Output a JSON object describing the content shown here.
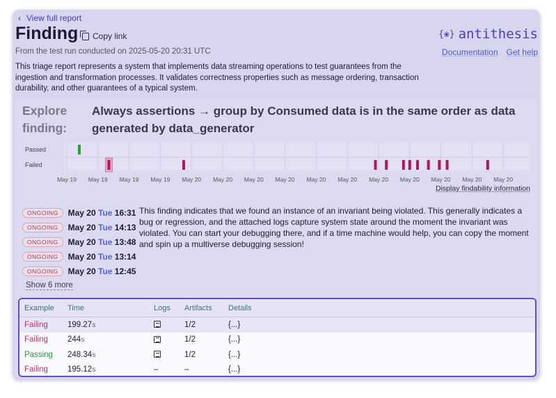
{
  "nav": {
    "back_label": "View full report"
  },
  "header": {
    "title": "Finding",
    "copy_link": "Copy link",
    "subtitle": "From the test run conducted on 2025-05-20 20:31 UTC",
    "logo_text": "antithesis",
    "logo_bug": "{❀}",
    "links": [
      "Documentation",
      "Get help"
    ]
  },
  "description": "This triage report represents a system that implements data streaming operations to test guarantees from the ingestion and transformation processes. It validates correctness properties such as message ordering, transaction durability, and other guarantees of a typical system.",
  "explore": {
    "label": "Explore finding:",
    "finding_title": "Always assertions → group by Consumed data is in the same order as data generated by data_generator"
  },
  "chart_data": {
    "type": "scatter",
    "rows": [
      "Passed",
      "Failed"
    ],
    "x_ticks": [
      "May 19",
      "May 19",
      "May 19",
      "May 19",
      "May 20",
      "May 20",
      "May 20",
      "May 20",
      "May 20",
      "May 20",
      "May 20",
      "May 20",
      "May 20",
      "May 20",
      "May 20"
    ],
    "passed_tick_indices": [
      0.4
    ],
    "failed_tick_indices": [
      1.35,
      3.75,
      9.9,
      10.25,
      10.8,
      11.0,
      11.25,
      11.6,
      11.95,
      12.2,
      13.5
    ],
    "highlighted_failed": 1.35,
    "colors": {
      "passed": "#2a9a3a",
      "failed": "#b0185c"
    }
  },
  "findability_link": "Display findability information",
  "events": [
    {
      "status": "ONGOING",
      "md": "May 20",
      "dw": "Tue",
      "time": "16:31"
    },
    {
      "status": "ONGOING",
      "md": "May 20",
      "dw": "Tue",
      "time": "14:13"
    },
    {
      "status": "ONGOING",
      "md": "May 20",
      "dw": "Tue",
      "time": "13:48"
    },
    {
      "status": "ONGOING",
      "md": "May 20",
      "dw": "Tue",
      "time": "13:14"
    },
    {
      "status": "ONGOING",
      "md": "May 20",
      "dw": "Tue",
      "time": "12:45"
    }
  ],
  "show_more": "Show 6 more",
  "finding_text": "This finding indicates that we found an instance of an invariant being violated. This generally indicates a bug or regression, and the attached logs capture system state around the moment the invariant was violated. You can start your debugging there, and if a time machine would help, you can copy the moment and spin up a multiverse debugging session!",
  "table": {
    "headers": [
      "Example",
      "Time",
      "Logs",
      "Artifacts",
      "Details"
    ],
    "rows": [
      {
        "example": "Failing",
        "time": "199.27",
        "unit": "s",
        "logs": true,
        "artifacts": "1/2",
        "details": "{...}"
      },
      {
        "example": "Failing",
        "time": "244",
        "unit": "s",
        "logs": true,
        "artifacts": "1/2",
        "details": "{...}"
      },
      {
        "example": "Passing",
        "time": "248.34",
        "unit": "s",
        "logs": true,
        "artifacts": "1/2",
        "details": "{...}"
      },
      {
        "example": "Failing",
        "time": "195.12",
        "unit": "s",
        "logs": false,
        "artifacts": "–",
        "details": "{...}"
      }
    ],
    "dash": "–"
  }
}
